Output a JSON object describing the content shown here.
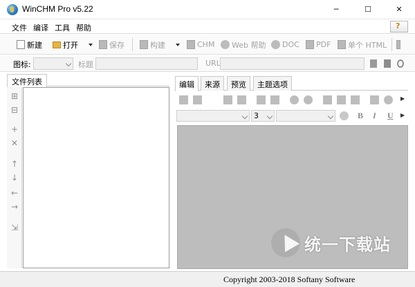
{
  "window": {
    "title": "WinCHM Pro v5.22",
    "minimize": "─",
    "maximize": "☐",
    "close": "✕"
  },
  "menu": {
    "file": "文件",
    "edit": "编译",
    "tools": "工具",
    "help": "帮助",
    "help_button": "?"
  },
  "toolbar": {
    "new": "新建",
    "open": "打开",
    "save": "保存",
    "build": "构建",
    "chm": "CHM",
    "web_help": "Web 帮助",
    "doc": "DOC",
    "pdf": "PDF",
    "single_html": "单个 HTML"
  },
  "properties": {
    "icon_label": "图标:",
    "title_label": "标题",
    "title_value": "",
    "url_label": "URL",
    "url_value": ""
  },
  "left_panel": {
    "tab_label": "文件列表"
  },
  "right_panel": {
    "tabs": [
      "编辑",
      "来源",
      "预览",
      "主题选项"
    ],
    "font_size": "3",
    "bold": "B",
    "italic": "I",
    "underline": "U"
  },
  "status": {
    "copyright": "Copyright 2003-2018 Softany Software"
  },
  "watermark": {
    "text": "统一下载站"
  },
  "colors": {
    "editor_bg": "#bdbdbd",
    "disabled_text": "#a3a3a3"
  }
}
